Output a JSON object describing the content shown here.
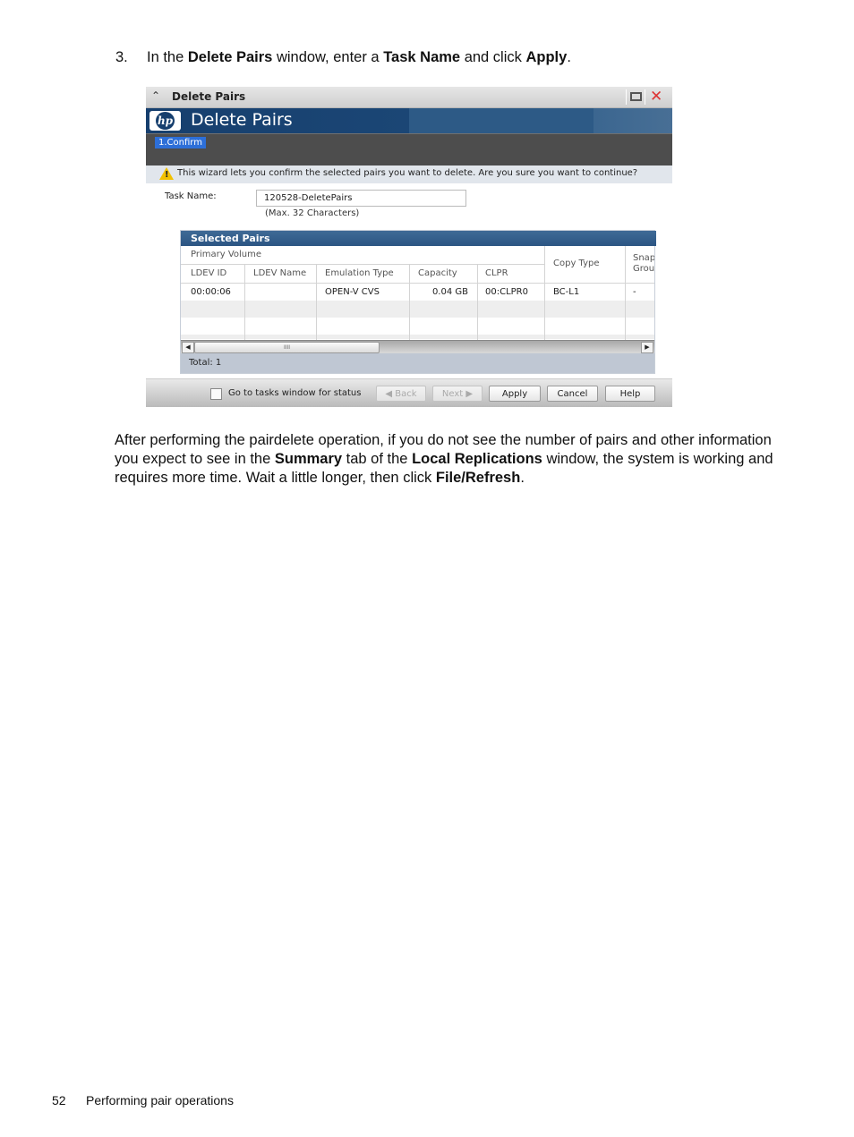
{
  "document": {
    "step_number": "3.",
    "step_text": [
      {
        "t": "In the ",
        "b": false
      },
      {
        "t": "Delete Pairs",
        "b": true
      },
      {
        "t": " window, enter a ",
        "b": false
      },
      {
        "t": "Task Name",
        "b": true
      },
      {
        "t": " and click ",
        "b": false
      },
      {
        "t": "Apply",
        "b": true
      },
      {
        "t": ".",
        "b": false
      }
    ],
    "paragraph": [
      {
        "t": "After performing the pairdelete operation, if you do not see the number of pairs and other information you expect to see in the ",
        "b": false
      },
      {
        "t": "Summary",
        "b": true
      },
      {
        "t": " tab of the ",
        "b": false
      },
      {
        "t": "Local Replications",
        "b": true
      },
      {
        "t": " window, the system is working and requires more time. Wait a little longer, then click ",
        "b": false
      },
      {
        "t": "File/Refresh",
        "b": true
      },
      {
        "t": ".",
        "b": false
      }
    ],
    "footer": {
      "page_number": "52",
      "section": "Performing pair operations"
    }
  },
  "window": {
    "titlebar_title": "Delete Pairs",
    "icons": {
      "collapse": "double-chevron-up-icon",
      "maximize": "maximize-icon",
      "close": "close-icon",
      "logo": "hp-logo",
      "warning": "warning-icon"
    },
    "collapse_glyph": "⌃",
    "close_glyph": "✕",
    "logo_text": "hp",
    "banner_title": "Delete Pairs",
    "steps": [
      "1.Confirm"
    ],
    "notice": "This wizard lets you confirm the selected pairs you want to delete. Are you sure you want to continue?",
    "task_name_label": "Task Name:",
    "task_name_value": "120528-DeletePairs",
    "task_name_hint": "(Max. 32 Characters)",
    "selected_pairs": {
      "title": "Selected Pairs",
      "group_header": "Primary Volume",
      "columns": [
        "LDEV ID",
        "LDEV Name",
        "Emulation Type",
        "Capacity",
        "CLPR",
        "Copy Type",
        "Snap Grou"
      ],
      "snap_header_lines": [
        "Snap",
        "Grou"
      ],
      "rows": [
        [
          "00:00:06",
          "",
          "OPEN-V CVS",
          "0.04 GB",
          "00:CLPR0",
          "BC-L1",
          "-"
        ]
      ],
      "scroll_left_glyph": "◀",
      "scroll_right_glyph": "▶",
      "scroll_thumb_grip": "IIII",
      "total_label": "Total:  1"
    },
    "go_to_tasks_label": "Go to tasks window for status",
    "go_to_tasks_checked": false,
    "buttons": {
      "back": "◀ Back",
      "next": "Next ▶",
      "apply": "Apply",
      "cancel": "Cancel",
      "help": "Help"
    }
  }
}
